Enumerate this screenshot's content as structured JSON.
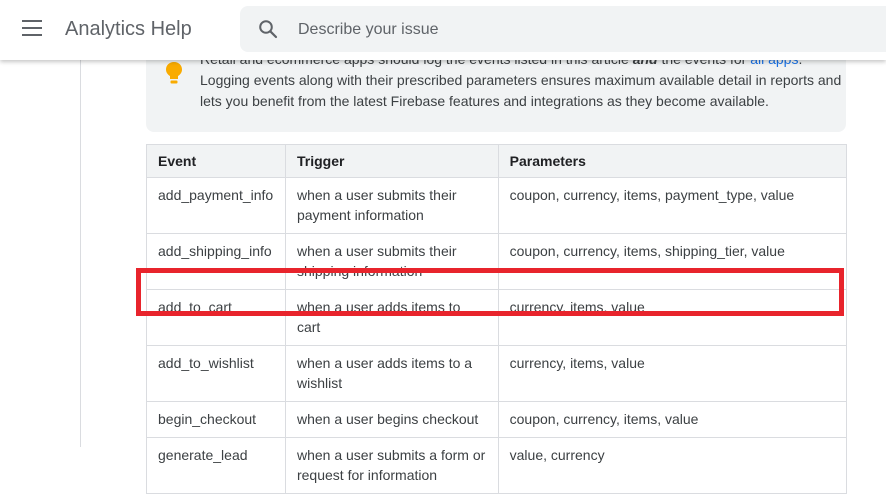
{
  "header": {
    "app_title": "Analytics Help",
    "search_placeholder": "Describe your issue"
  },
  "note": {
    "line1_pre": "Retail and ecommerce apps should log the events listed in this article ",
    "line1_em": "and",
    "line1_mid": " the events for ",
    "line1_link": "all apps",
    "line1_post": ".",
    "line2": "Logging events along with their prescribed parameters ensures maximum available detail in reports and",
    "line3": "lets you benefit from the latest Firebase features and integrations as they become available."
  },
  "table": {
    "headers": [
      "Event",
      "Trigger",
      "Parameters"
    ],
    "rows": [
      [
        "add_payment_info",
        "when a user submits their payment information",
        "coupon, currency, items, payment_type, value"
      ],
      [
        "add_shipping_info",
        "when a user submits their shipping information",
        "coupon, currency, items, shipping_tier, value"
      ],
      [
        "add_to_cart",
        "when a user adds items to cart",
        "currency, items, value"
      ],
      [
        "add_to_wishlist",
        "when a user adds items to a wishlist",
        "currency, items, value"
      ],
      [
        "begin_checkout",
        "when a user begins checkout",
        "coupon, currency, items, value"
      ],
      [
        "generate_lead",
        "when a user submits a form or request for information",
        "value, currency"
      ]
    ]
  },
  "highlighted_row": "add_to_cart",
  "colors": {
    "highlight": "#e8242c",
    "link": "#1a73e8",
    "bulb": "#f9ab00"
  },
  "icons": [
    "menu-icon",
    "search-icon",
    "lightbulb-icon"
  ]
}
